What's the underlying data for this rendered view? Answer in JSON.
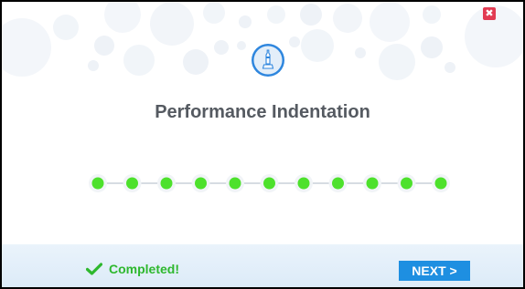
{
  "dialog": {
    "title": "Performance Indentation",
    "close_label": "✖"
  },
  "progress": {
    "total_steps": 11,
    "completed_steps": 11,
    "dot_color": "#4de12c",
    "line_color": "#c8d0d8"
  },
  "footer": {
    "status_label": "Completed!",
    "status_color": "#2eb82e",
    "next_label": "NEXT >",
    "next_color": "#1e8fe1"
  },
  "icons": {
    "app": "pen-icon",
    "status": "checkmark-icon",
    "close": "close-icon"
  }
}
